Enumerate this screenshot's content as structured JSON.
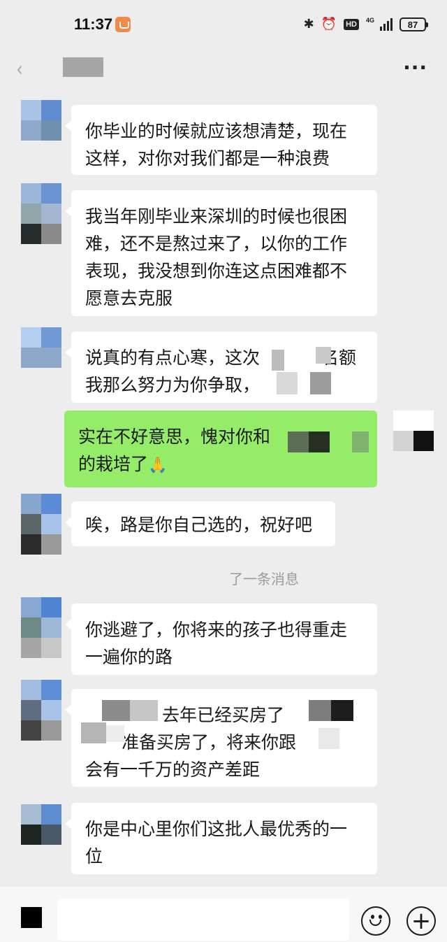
{
  "status_bar": {
    "time": "11:37",
    "battery": "87",
    "network": "4G",
    "hd_label": "HD",
    "bluetooth_icon": "✱",
    "alarm_icon": "⏰"
  },
  "nav": {
    "back_icon": "‹",
    "more_icon": "···"
  },
  "messages": [
    {
      "lines": [
        "你毕业的时候就应该想清楚，现在",
        "这样，对你对我们都是一种浪费"
      ]
    },
    {
      "lines": [
        "我当年刚毕业来深圳的时候也很困",
        "难，还不是熬过来了，以你的工作",
        "表现，我没想到你连这点困难都不",
        "愿意去克服"
      ]
    },
    {
      "lines": [
        "说真的有点心寒，这次",
        "我那么努力为你争取，"
      ],
      "partial_line1_tail": "名额",
      "partial_line2_tail": ""
    },
    {
      "lines": [
        "实在不好意思，愧对你和",
        "的栽培了"
      ],
      "emoji": "🙏"
    },
    {
      "lines": [
        "唉，路是你自己选的，祝好吧"
      ]
    },
    {
      "lines": [
        "你逃避了，你将来的孩子也得重走",
        "一遍你的路"
      ]
    },
    {
      "lines": [
        "去年已经买房了",
        "准备买房了，将来你跟",
        "会有一千万的资产差距"
      ]
    },
    {
      "lines": [
        "你是中心里你们这批人最优秀的一",
        "位"
      ]
    }
  ],
  "system_note": "了一条消息",
  "input": {
    "emoji_icon": "smile-icon",
    "plus_icon": "+"
  }
}
